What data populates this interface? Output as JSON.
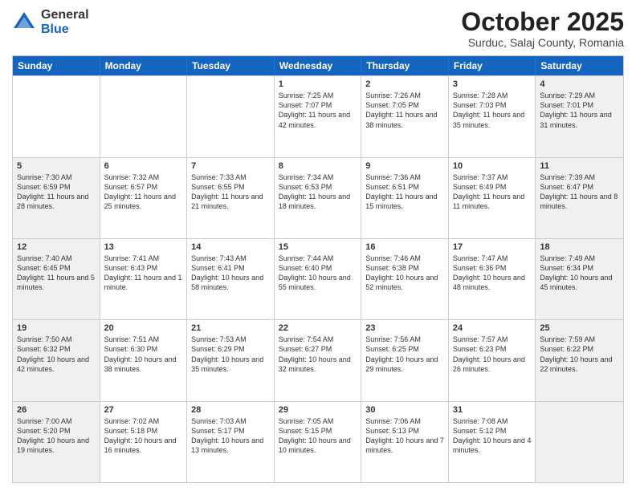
{
  "header": {
    "logo_general": "General",
    "logo_blue": "Blue",
    "month": "October 2025",
    "location": "Surduc, Salaj County, Romania"
  },
  "days_of_week": [
    "Sunday",
    "Monday",
    "Tuesday",
    "Wednesday",
    "Thursday",
    "Friday",
    "Saturday"
  ],
  "weeks": [
    [
      {
        "day": "",
        "text": "",
        "shaded": false
      },
      {
        "day": "",
        "text": "",
        "shaded": false
      },
      {
        "day": "",
        "text": "",
        "shaded": false
      },
      {
        "day": "1",
        "text": "Sunrise: 7:25 AM\nSunset: 7:07 PM\nDaylight: 11 hours and 42 minutes.",
        "shaded": false
      },
      {
        "day": "2",
        "text": "Sunrise: 7:26 AM\nSunset: 7:05 PM\nDaylight: 11 hours and 38 minutes.",
        "shaded": false
      },
      {
        "day": "3",
        "text": "Sunrise: 7:28 AM\nSunset: 7:03 PM\nDaylight: 11 hours and 35 minutes.",
        "shaded": false
      },
      {
        "day": "4",
        "text": "Sunrise: 7:29 AM\nSunset: 7:01 PM\nDaylight: 11 hours and 31 minutes.",
        "shaded": true
      }
    ],
    [
      {
        "day": "5",
        "text": "Sunrise: 7:30 AM\nSunset: 6:59 PM\nDaylight: 11 hours and 28 minutes.",
        "shaded": true
      },
      {
        "day": "6",
        "text": "Sunrise: 7:32 AM\nSunset: 6:57 PM\nDaylight: 11 hours and 25 minutes.",
        "shaded": false
      },
      {
        "day": "7",
        "text": "Sunrise: 7:33 AM\nSunset: 6:55 PM\nDaylight: 11 hours and 21 minutes.",
        "shaded": false
      },
      {
        "day": "8",
        "text": "Sunrise: 7:34 AM\nSunset: 6:53 PM\nDaylight: 11 hours and 18 minutes.",
        "shaded": false
      },
      {
        "day": "9",
        "text": "Sunrise: 7:36 AM\nSunset: 6:51 PM\nDaylight: 11 hours and 15 minutes.",
        "shaded": false
      },
      {
        "day": "10",
        "text": "Sunrise: 7:37 AM\nSunset: 6:49 PM\nDaylight: 11 hours and 11 minutes.",
        "shaded": false
      },
      {
        "day": "11",
        "text": "Sunrise: 7:39 AM\nSunset: 6:47 PM\nDaylight: 11 hours and 8 minutes.",
        "shaded": true
      }
    ],
    [
      {
        "day": "12",
        "text": "Sunrise: 7:40 AM\nSunset: 6:45 PM\nDaylight: 11 hours and 5 minutes.",
        "shaded": true
      },
      {
        "day": "13",
        "text": "Sunrise: 7:41 AM\nSunset: 6:43 PM\nDaylight: 11 hours and 1 minute.",
        "shaded": false
      },
      {
        "day": "14",
        "text": "Sunrise: 7:43 AM\nSunset: 6:41 PM\nDaylight: 10 hours and 58 minutes.",
        "shaded": false
      },
      {
        "day": "15",
        "text": "Sunrise: 7:44 AM\nSunset: 6:40 PM\nDaylight: 10 hours and 55 minutes.",
        "shaded": false
      },
      {
        "day": "16",
        "text": "Sunrise: 7:46 AM\nSunset: 6:38 PM\nDaylight: 10 hours and 52 minutes.",
        "shaded": false
      },
      {
        "day": "17",
        "text": "Sunrise: 7:47 AM\nSunset: 6:36 PM\nDaylight: 10 hours and 48 minutes.",
        "shaded": false
      },
      {
        "day": "18",
        "text": "Sunrise: 7:49 AM\nSunset: 6:34 PM\nDaylight: 10 hours and 45 minutes.",
        "shaded": true
      }
    ],
    [
      {
        "day": "19",
        "text": "Sunrise: 7:50 AM\nSunset: 6:32 PM\nDaylight: 10 hours and 42 minutes.",
        "shaded": true
      },
      {
        "day": "20",
        "text": "Sunrise: 7:51 AM\nSunset: 6:30 PM\nDaylight: 10 hours and 38 minutes.",
        "shaded": false
      },
      {
        "day": "21",
        "text": "Sunrise: 7:53 AM\nSunset: 6:29 PM\nDaylight: 10 hours and 35 minutes.",
        "shaded": false
      },
      {
        "day": "22",
        "text": "Sunrise: 7:54 AM\nSunset: 6:27 PM\nDaylight: 10 hours and 32 minutes.",
        "shaded": false
      },
      {
        "day": "23",
        "text": "Sunrise: 7:56 AM\nSunset: 6:25 PM\nDaylight: 10 hours and 29 minutes.",
        "shaded": false
      },
      {
        "day": "24",
        "text": "Sunrise: 7:57 AM\nSunset: 6:23 PM\nDaylight: 10 hours and 26 minutes.",
        "shaded": false
      },
      {
        "day": "25",
        "text": "Sunrise: 7:59 AM\nSunset: 6:22 PM\nDaylight: 10 hours and 22 minutes.",
        "shaded": true
      }
    ],
    [
      {
        "day": "26",
        "text": "Sunrise: 7:00 AM\nSunset: 5:20 PM\nDaylight: 10 hours and 19 minutes.",
        "shaded": true
      },
      {
        "day": "27",
        "text": "Sunrise: 7:02 AM\nSunset: 5:18 PM\nDaylight: 10 hours and 16 minutes.",
        "shaded": false
      },
      {
        "day": "28",
        "text": "Sunrise: 7:03 AM\nSunset: 5:17 PM\nDaylight: 10 hours and 13 minutes.",
        "shaded": false
      },
      {
        "day": "29",
        "text": "Sunrise: 7:05 AM\nSunset: 5:15 PM\nDaylight: 10 hours and 10 minutes.",
        "shaded": false
      },
      {
        "day": "30",
        "text": "Sunrise: 7:06 AM\nSunset: 5:13 PM\nDaylight: 10 hours and 7 minutes.",
        "shaded": false
      },
      {
        "day": "31",
        "text": "Sunrise: 7:08 AM\nSunset: 5:12 PM\nDaylight: 10 hours and 4 minutes.",
        "shaded": false
      },
      {
        "day": "",
        "text": "",
        "shaded": true
      }
    ]
  ]
}
